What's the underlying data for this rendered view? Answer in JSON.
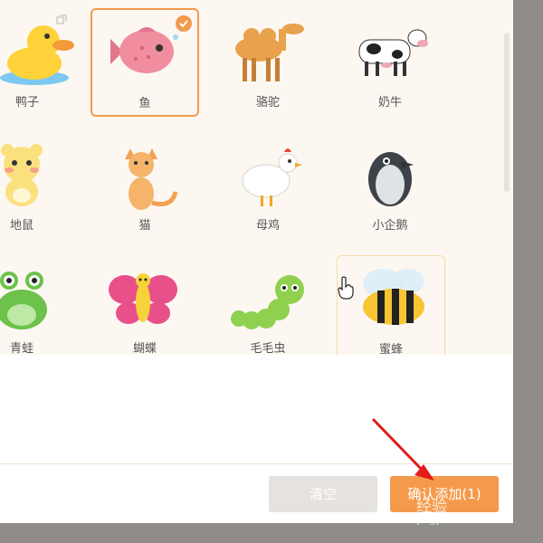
{
  "animals": [
    {
      "label": "鸭子",
      "icon": "duck-icon"
    },
    {
      "label": "鱼",
      "icon": "fish-icon",
      "selected": true
    },
    {
      "label": "骆驼",
      "icon": "camel-icon"
    },
    {
      "label": "奶牛",
      "icon": "cow-icon"
    },
    {
      "label": "地鼠",
      "icon": "hamster-icon"
    },
    {
      "label": "猫",
      "icon": "cat-icon"
    },
    {
      "label": "母鸡",
      "icon": "hen-icon"
    },
    {
      "label": "小企鹅",
      "icon": "penguin-icon"
    },
    {
      "label": "青蛙",
      "icon": "frog-icon"
    },
    {
      "label": "蝴蝶",
      "icon": "butterfly-icon"
    },
    {
      "label": "毛毛虫",
      "icon": "caterpillar-icon"
    },
    {
      "label": "蜜蜂",
      "icon": "bee-icon",
      "hovered": true
    }
  ],
  "buttons": {
    "clear": "清空",
    "confirm": "确认添加(1)"
  },
  "watermark": {
    "brand": "经验",
    "url": "jingyan.baidu.com"
  },
  "colors": {
    "accent": "#f39a4c",
    "grid_bg": "#fdf7f2",
    "overlay": "#8f8c89"
  }
}
